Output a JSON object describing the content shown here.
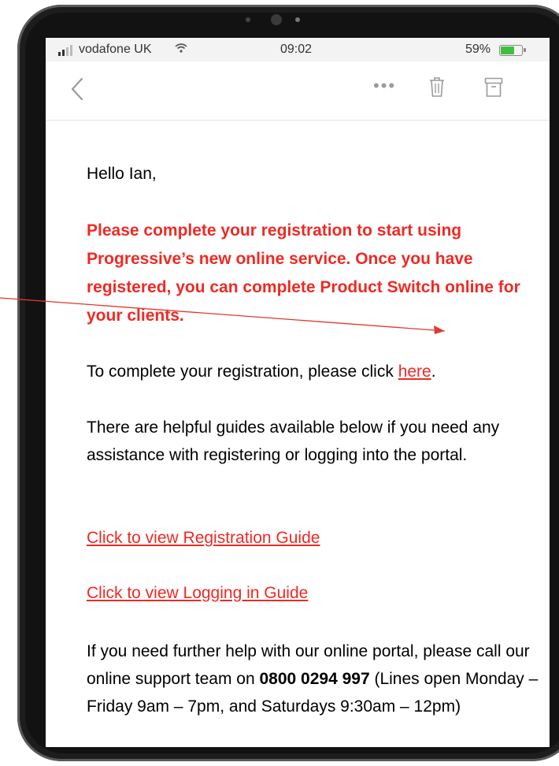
{
  "status_bar": {
    "carrier": "vodafone UK",
    "time": "09:02",
    "battery": "59%",
    "battery_level": 0.59
  },
  "nav": {
    "back_icon": "chevron-left-icon",
    "more_icon": "more-dots-icon",
    "trash_icon": "trash-icon",
    "archive_icon": "archive-icon"
  },
  "email": {
    "greeting": "Hello Ian,",
    "highlight": "Please complete your registration to start using Progressive’s new online service. Once you have registered, you can complete Product Switch online for your clients.",
    "registration_prefix": "To complete your registration, please click ",
    "registration_link": "here",
    "registration_suffix": ".",
    "guides_intro": "There are helpful guides available below if you need any assistance with registering or logging into the portal.",
    "guide_registration": "Click to view Registration Guide",
    "guide_logging_in": "Click to view Logging in Guide",
    "help_prefix": "If you need further help with our online portal, please call our online support team on ",
    "help_phone": "0800 0294 997",
    "help_suffix": " (Lines open Monday – Friday 9am – 7pm, and Saturdays 9:30am – 12pm)"
  },
  "colors": {
    "accent_red": "#ee2a24",
    "device_frame": "#1d1d1d"
  }
}
